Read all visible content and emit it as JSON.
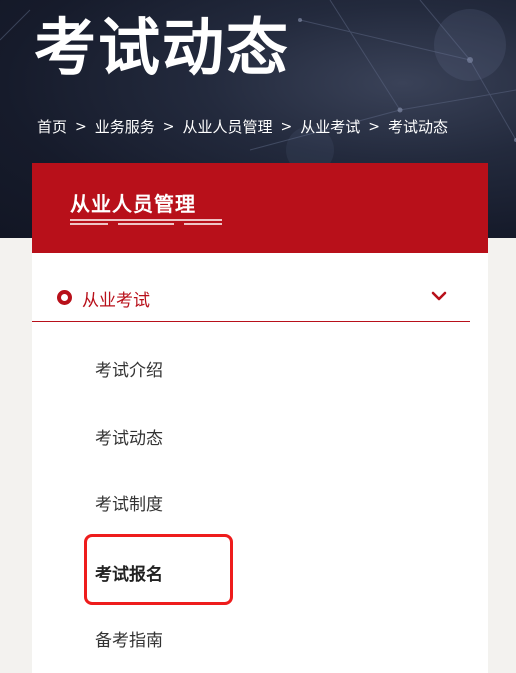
{
  "banner": {
    "title": "考试动态",
    "breadcrumb": [
      {
        "label": "首页"
      },
      {
        "label": "业务服务"
      },
      {
        "label": "从业人员管理"
      },
      {
        "label": "从业考试"
      },
      {
        "label": "考试动态"
      }
    ],
    "separator": ">"
  },
  "sidebar": {
    "header_title": "从业人员管理",
    "category": {
      "label": "从业考试",
      "icon": "chevron-down-icon",
      "expanded": true
    },
    "items": [
      {
        "label": "考试介绍"
      },
      {
        "label": "考试动态"
      },
      {
        "label": "考试制度"
      },
      {
        "label": "考试报名",
        "bold": true,
        "highlighted": true
      },
      {
        "label": "备考指南"
      }
    ]
  },
  "colors": {
    "accent": "#b8101a",
    "banner_bg": "#161b2b",
    "highlight_border": "#ee1c1c",
    "page_bg": "#f3f2ef"
  }
}
